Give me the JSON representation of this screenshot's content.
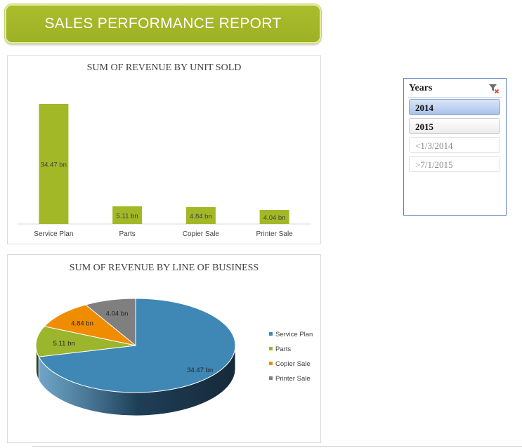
{
  "banner": {
    "title": "SALES PERFORMANCE REPORT"
  },
  "colors": {
    "accent": "#a3b826",
    "blue": "#3f87b4",
    "green": "#9bb52c",
    "orange": "#f08c00",
    "gray": "#7f7f7f"
  },
  "slicer": {
    "title": "Years",
    "clear_icon": "clear-filter-icon",
    "items": [
      {
        "label": "2014",
        "state": "selected"
      },
      {
        "label": "2015",
        "state": "normal"
      },
      {
        "label": "<1/3/2014",
        "state": "disabled"
      },
      {
        "label": ">7/1/2015",
        "state": "disabled"
      }
    ]
  },
  "chart_data": [
    {
      "type": "bar",
      "title": "SUM OF REVENUE BY UNIT SOLD",
      "categories": [
        "Service Plan",
        "Parts",
        "Copier Sale",
        "Printer Sale"
      ],
      "values": [
        34.47,
        5.11,
        4.84,
        4.04
      ],
      "data_labels": [
        "34.47 bn",
        "5.11 bn",
        "4.84 bn",
        "4.04 bn"
      ],
      "unit": "bn",
      "ylim": [
        0,
        34.47
      ],
      "grid": false,
      "legend": "none",
      "color": "#a3b826"
    },
    {
      "type": "pie",
      "title": "SUM OF REVENUE BY LINE OF BUSINESS",
      "categories": [
        "Service Plan",
        "Parts",
        "Copier Sale",
        "Printer Sale"
      ],
      "values": [
        34.47,
        5.11,
        4.84,
        4.04
      ],
      "data_labels": [
        "34.47 bn",
        "5.11 bn",
        "4.84 bn",
        "4.04 bn"
      ],
      "colors": [
        "#3f87b4",
        "#9bb52c",
        "#f08c00",
        "#7f7f7f"
      ],
      "legend": "right",
      "style": "3d"
    }
  ]
}
